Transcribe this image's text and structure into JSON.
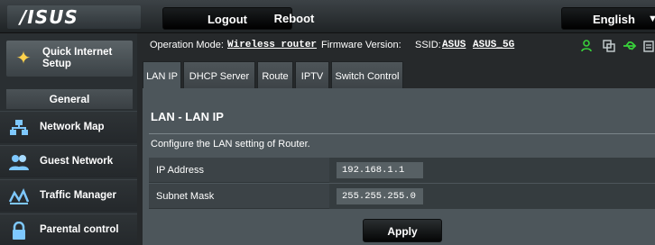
{
  "header": {
    "logo": "/ISUS",
    "logout": "Logout",
    "reboot": "Reboot",
    "language": "English"
  },
  "sidebar": {
    "quick_setup": "Quick Internet Setup",
    "section_title": "General",
    "items": [
      {
        "label": "Network Map",
        "icon": "network-map-icon"
      },
      {
        "label": "Guest Network",
        "icon": "guest-network-icon"
      },
      {
        "label": "Traffic Manager",
        "icon": "traffic-manager-icon"
      },
      {
        "label": "Parental control",
        "icon": "lock-icon"
      }
    ]
  },
  "status": {
    "op_mode_label": "Operation Mode:",
    "op_mode_value": "Wireless router",
    "fw_label": "Firmware Version:",
    "ssid_label": "SSID:",
    "ssid_1": "ASUS",
    "ssid_2": "ASUS_5G"
  },
  "tabs": [
    "LAN IP",
    "DHCP Server",
    "Route",
    "IPTV",
    "Switch Control"
  ],
  "panel": {
    "title": "LAN - LAN IP",
    "description": "Configure the LAN setting of Router.",
    "fields": [
      {
        "label": "IP Address",
        "value": "192.168.1.1"
      },
      {
        "label": "Subnet Mask",
        "value": "255.255.255.0"
      }
    ],
    "apply": "Apply"
  },
  "colors": {
    "panel_bg": "#4d565b",
    "accent_green": "#38d13a",
    "icon_blue": "#7ec8ff"
  }
}
